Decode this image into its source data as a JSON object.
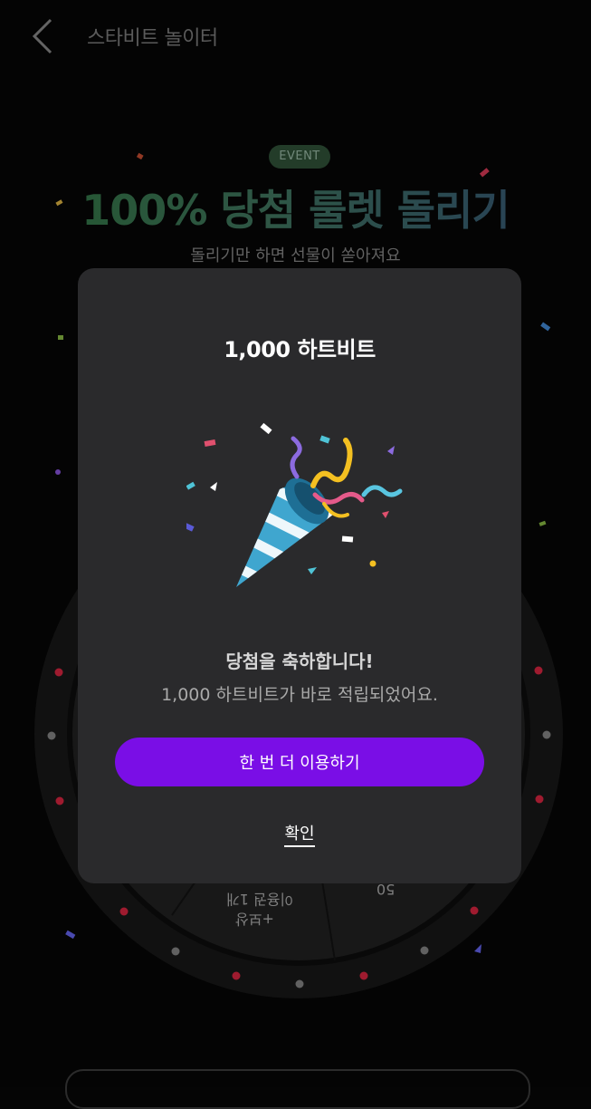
{
  "header": {
    "title": "스타비트 놀이터",
    "back_icon": "chevron-left-icon"
  },
  "event": {
    "badge": "EVENT",
    "title": "100% 당첨 룰렛 돌리기",
    "subtitle": "돌리기만 하면 선물이 쏟아져요",
    "title_gradient": [
      "#2a6b39",
      "#2f4b6e"
    ]
  },
  "wheel": {
    "labels": [
      "+보상",
      "이용권 1개",
      "50"
    ]
  },
  "modal": {
    "amount": "1,000 하트비트",
    "icon": "party-popper-icon",
    "congrats": "당첨을 축하합니다!",
    "message": "1,000 하트비트가 바로 적립되었어요.",
    "retry_button": "한 번 더 이용하기",
    "confirm_button": "확인"
  },
  "colors": {
    "accent": "#7a0ee6",
    "modal_bg": "#2a2a2c",
    "page_bg": "#050505"
  }
}
